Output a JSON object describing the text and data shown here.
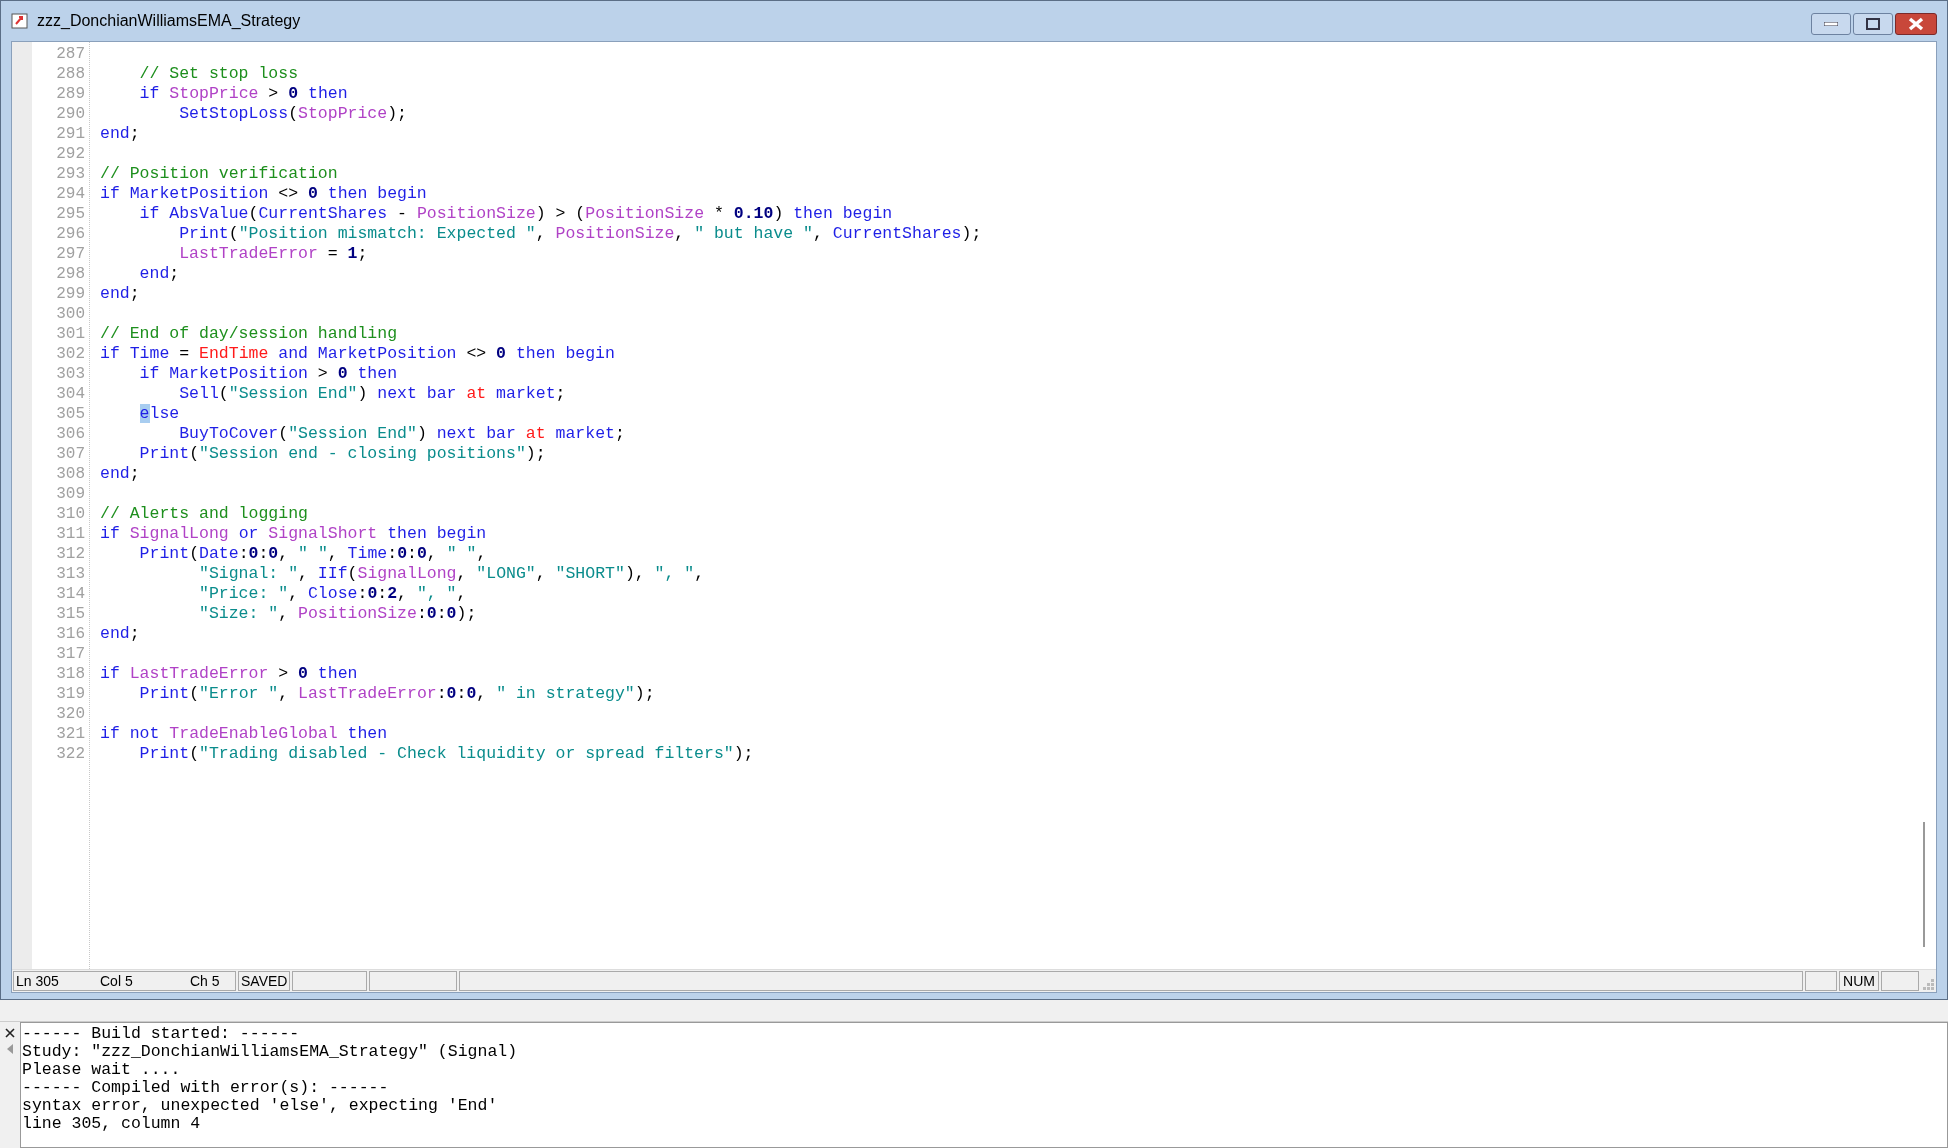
{
  "window": {
    "title": "zzz_DonchianWilliamsEMA_Strategy"
  },
  "editor": {
    "lines": [
      {
        "number": "287"
      },
      {
        "number": "288",
        "tokens": [
          {
            "kind": "cm",
            "text": "    // Set stop loss"
          }
        ]
      },
      {
        "number": "289",
        "tokens": [
          {
            "kind": "kw",
            "text": "    if"
          },
          {
            "kind": "var",
            "text": " StopPrice"
          },
          {
            "kind": "pl",
            "text": " > "
          },
          {
            "kind": "num",
            "text": "0"
          },
          {
            "kind": "kw",
            "text": " then"
          }
        ]
      },
      {
        "number": "290",
        "tokens": [
          {
            "kind": "kw",
            "text": "        SetStopLoss"
          },
          {
            "kind": "pl",
            "text": "("
          },
          {
            "kind": "var",
            "text": "StopPrice"
          },
          {
            "kind": "pl",
            "text": ");"
          }
        ]
      },
      {
        "number": "291",
        "tokens": [
          {
            "kind": "kw",
            "text": "end"
          },
          {
            "kind": "pl",
            "text": ";"
          }
        ]
      },
      {
        "number": "292"
      },
      {
        "number": "293",
        "tokens": [
          {
            "kind": "cm",
            "text": "// Position verification"
          }
        ]
      },
      {
        "number": "294",
        "tokens": [
          {
            "kind": "kw",
            "text": "if MarketPosition"
          },
          {
            "kind": "pl",
            "text": " <> "
          },
          {
            "kind": "num",
            "text": "0"
          },
          {
            "kind": "kw",
            "text": " then begin"
          }
        ]
      },
      {
        "number": "295",
        "tokens": [
          {
            "kind": "kw",
            "text": "    if AbsValue"
          },
          {
            "kind": "pl",
            "text": "("
          },
          {
            "kind": "kw",
            "text": "CurrentShares"
          },
          {
            "kind": "pl",
            "text": " - "
          },
          {
            "kind": "var",
            "text": "PositionSize"
          },
          {
            "kind": "pl",
            "text": ") > ("
          },
          {
            "kind": "var",
            "text": "PositionSize"
          },
          {
            "kind": "pl",
            "text": " * "
          },
          {
            "kind": "num",
            "text": "0.10"
          },
          {
            "kind": "pl",
            "text": ") "
          },
          {
            "kind": "kw",
            "text": "then begin"
          }
        ]
      },
      {
        "number": "296",
        "tokens": [
          {
            "kind": "kw",
            "text": "        Print"
          },
          {
            "kind": "pl",
            "text": "("
          },
          {
            "kind": "str",
            "text": "\"Position mismatch: Expected \""
          },
          {
            "kind": "pl",
            "text": ", "
          },
          {
            "kind": "var",
            "text": "PositionSize"
          },
          {
            "kind": "pl",
            "text": ", "
          },
          {
            "kind": "str",
            "text": "\" but have \""
          },
          {
            "kind": "pl",
            "text": ", "
          },
          {
            "kind": "kw",
            "text": "CurrentShares"
          },
          {
            "kind": "pl",
            "text": ");"
          }
        ]
      },
      {
        "number": "297",
        "tokens": [
          {
            "kind": "var",
            "text": "        LastTradeError"
          },
          {
            "kind": "pl",
            "text": " = "
          },
          {
            "kind": "num",
            "text": "1"
          },
          {
            "kind": "pl",
            "text": ";"
          }
        ]
      },
      {
        "number": "298",
        "tokens": [
          {
            "kind": "kw",
            "text": "    end"
          },
          {
            "kind": "pl",
            "text": ";"
          }
        ]
      },
      {
        "number": "299",
        "tokens": [
          {
            "kind": "kw",
            "text": "end"
          },
          {
            "kind": "pl",
            "text": ";"
          }
        ]
      },
      {
        "number": "300"
      },
      {
        "number": "301",
        "tokens": [
          {
            "kind": "cm",
            "text": "// End of day/session handling"
          }
        ]
      },
      {
        "number": "302",
        "tokens": [
          {
            "kind": "kw",
            "text": "if Time"
          },
          {
            "kind": "pl",
            "text": " = "
          },
          {
            "kind": "red",
            "text": "EndTime"
          },
          {
            "kind": "kw",
            "text": " and MarketPosition"
          },
          {
            "kind": "pl",
            "text": " <> "
          },
          {
            "kind": "num",
            "text": "0"
          },
          {
            "kind": "kw",
            "text": " then begin"
          }
        ]
      },
      {
        "number": "303",
        "tokens": [
          {
            "kind": "kw",
            "text": "    if MarketPosition"
          },
          {
            "kind": "pl",
            "text": " > "
          },
          {
            "kind": "num",
            "text": "0"
          },
          {
            "kind": "kw",
            "text": " then"
          }
        ]
      },
      {
        "number": "304",
        "tokens": [
          {
            "kind": "kw",
            "text": "        Sell"
          },
          {
            "kind": "pl",
            "text": "("
          },
          {
            "kind": "str",
            "text": "\"Session End\""
          },
          {
            "kind": "pl",
            "text": ") "
          },
          {
            "kind": "kw",
            "text": "next bar"
          },
          {
            "kind": "red",
            "text": " at"
          },
          {
            "kind": "kw",
            "text": " market"
          },
          {
            "kind": "pl",
            "text": ";"
          }
        ]
      },
      {
        "number": "305",
        "tokens": [
          {
            "kind": "hl",
            "text": "    e"
          },
          {
            "kind": "kw",
            "text": "lse"
          }
        ]
      },
      {
        "number": "306",
        "tokens": [
          {
            "kind": "kw",
            "text": "        BuyToCover"
          },
          {
            "kind": "pl",
            "text": "("
          },
          {
            "kind": "str",
            "text": "\"Session End\""
          },
          {
            "kind": "pl",
            "text": ") "
          },
          {
            "kind": "kw",
            "text": "next bar"
          },
          {
            "kind": "red",
            "text": " at"
          },
          {
            "kind": "kw",
            "text": " market"
          },
          {
            "kind": "pl",
            "text": ";"
          }
        ]
      },
      {
        "number": "307",
        "tokens": [
          {
            "kind": "kw",
            "text": "    Print"
          },
          {
            "kind": "pl",
            "text": "("
          },
          {
            "kind": "str",
            "text": "\"Session end - closing positions\""
          },
          {
            "kind": "pl",
            "text": ");"
          }
        ]
      },
      {
        "number": "308",
        "tokens": [
          {
            "kind": "kw",
            "text": "end"
          },
          {
            "kind": "pl",
            "text": ";"
          }
        ]
      },
      {
        "number": "309"
      },
      {
        "number": "310",
        "tokens": [
          {
            "kind": "cm",
            "text": "// Alerts and logging"
          }
        ]
      },
      {
        "number": "311",
        "tokens": [
          {
            "kind": "kw",
            "text": "if"
          },
          {
            "kind": "var",
            "text": " SignalLong"
          },
          {
            "kind": "kw",
            "text": " or"
          },
          {
            "kind": "var",
            "text": " SignalShort"
          },
          {
            "kind": "kw",
            "text": " then begin"
          }
        ]
      },
      {
        "number": "312",
        "tokens": [
          {
            "kind": "kw",
            "text": "    Print"
          },
          {
            "kind": "pl",
            "text": "("
          },
          {
            "kind": "kw",
            "text": "Date"
          },
          {
            "kind": "pl",
            "text": ":"
          },
          {
            "kind": "num",
            "text": "0"
          },
          {
            "kind": "pl",
            "text": ":"
          },
          {
            "kind": "num",
            "text": "0"
          },
          {
            "kind": "pl",
            "text": ", "
          },
          {
            "kind": "str",
            "text": "\" \""
          },
          {
            "kind": "pl",
            "text": ", "
          },
          {
            "kind": "kw",
            "text": "Time"
          },
          {
            "kind": "pl",
            "text": ":"
          },
          {
            "kind": "num",
            "text": "0"
          },
          {
            "kind": "pl",
            "text": ":"
          },
          {
            "kind": "num",
            "text": "0"
          },
          {
            "kind": "pl",
            "text": ", "
          },
          {
            "kind": "str",
            "text": "\" \""
          },
          {
            "kind": "pl",
            "text": ","
          }
        ]
      },
      {
        "number": "313",
        "tokens": [
          {
            "kind": "str",
            "text": "          \"Signal: \""
          },
          {
            "kind": "pl",
            "text": ", "
          },
          {
            "kind": "kw",
            "text": "IIf"
          },
          {
            "kind": "pl",
            "text": "("
          },
          {
            "kind": "var",
            "text": "SignalLong"
          },
          {
            "kind": "pl",
            "text": ", "
          },
          {
            "kind": "str",
            "text": "\"LONG\""
          },
          {
            "kind": "pl",
            "text": ", "
          },
          {
            "kind": "str",
            "text": "\"SHORT\""
          },
          {
            "kind": "pl",
            "text": "), "
          },
          {
            "kind": "str",
            "text": "\", \""
          },
          {
            "kind": "pl",
            "text": ","
          }
        ]
      },
      {
        "number": "314",
        "tokens": [
          {
            "kind": "str",
            "text": "          \"Price: \""
          },
          {
            "kind": "pl",
            "text": ", "
          },
          {
            "kind": "kw",
            "text": "Close"
          },
          {
            "kind": "pl",
            "text": ":"
          },
          {
            "kind": "num",
            "text": "0"
          },
          {
            "kind": "pl",
            "text": ":"
          },
          {
            "kind": "num",
            "text": "2"
          },
          {
            "kind": "pl",
            "text": ", "
          },
          {
            "kind": "str",
            "text": "\", \""
          },
          {
            "kind": "pl",
            "text": ","
          }
        ]
      },
      {
        "number": "315",
        "tokens": [
          {
            "kind": "str",
            "text": "          \"Size: \""
          },
          {
            "kind": "pl",
            "text": ", "
          },
          {
            "kind": "var",
            "text": "PositionSize"
          },
          {
            "kind": "pl",
            "text": ":"
          },
          {
            "kind": "num",
            "text": "0"
          },
          {
            "kind": "pl",
            "text": ":"
          },
          {
            "kind": "num",
            "text": "0"
          },
          {
            "kind": "pl",
            "text": ");"
          }
        ]
      },
      {
        "number": "316",
        "tokens": [
          {
            "kind": "kw",
            "text": "end"
          },
          {
            "kind": "pl",
            "text": ";"
          }
        ]
      },
      {
        "number": "317"
      },
      {
        "number": "318",
        "tokens": [
          {
            "kind": "kw",
            "text": "if"
          },
          {
            "kind": "var",
            "text": " LastTradeError"
          },
          {
            "kind": "pl",
            "text": " > "
          },
          {
            "kind": "num",
            "text": "0"
          },
          {
            "kind": "kw",
            "text": " then"
          }
        ]
      },
      {
        "number": "319",
        "tokens": [
          {
            "kind": "kw",
            "text": "    Print"
          },
          {
            "kind": "pl",
            "text": "("
          },
          {
            "kind": "str",
            "text": "\"Error \""
          },
          {
            "kind": "pl",
            "text": ", "
          },
          {
            "kind": "var",
            "text": "LastTradeError"
          },
          {
            "kind": "pl",
            "text": ":"
          },
          {
            "kind": "num",
            "text": "0"
          },
          {
            "kind": "pl",
            "text": ":"
          },
          {
            "kind": "num",
            "text": "0"
          },
          {
            "kind": "pl",
            "text": ", "
          },
          {
            "kind": "str",
            "text": "\" in strategy\""
          },
          {
            "kind": "pl",
            "text": ");"
          }
        ]
      },
      {
        "number": "320"
      },
      {
        "number": "321",
        "tokens": [
          {
            "kind": "kw",
            "text": "if not"
          },
          {
            "kind": "var",
            "text": " TradeEnableGlobal"
          },
          {
            "kind": "kw",
            "text": " then"
          }
        ]
      },
      {
        "number": "322",
        "tokens": [
          {
            "kind": "kw",
            "text": "    Print"
          },
          {
            "kind": "pl",
            "text": "("
          },
          {
            "kind": "str",
            "text": "\"Trading disabled - Check liquidity or spread filters\""
          },
          {
            "kind": "pl",
            "text": ");"
          }
        ]
      }
    ]
  },
  "status_bar": {
    "line": "Ln 305",
    "column": "Col 5",
    "char": "Ch 5",
    "save_state": "SAVED",
    "keyboard": "NUM"
  },
  "output": {
    "lines": [
      "------ Build started: ------",
      "Study: \"zzz_DonchianWilliamsEMA_Strategy\" (Signal)",
      "Please wait ....",
      "------ Compiled with error(s): ------",
      "syntax error, unexpected 'else', expecting 'End'",
      "line 305, column 4"
    ]
  }
}
